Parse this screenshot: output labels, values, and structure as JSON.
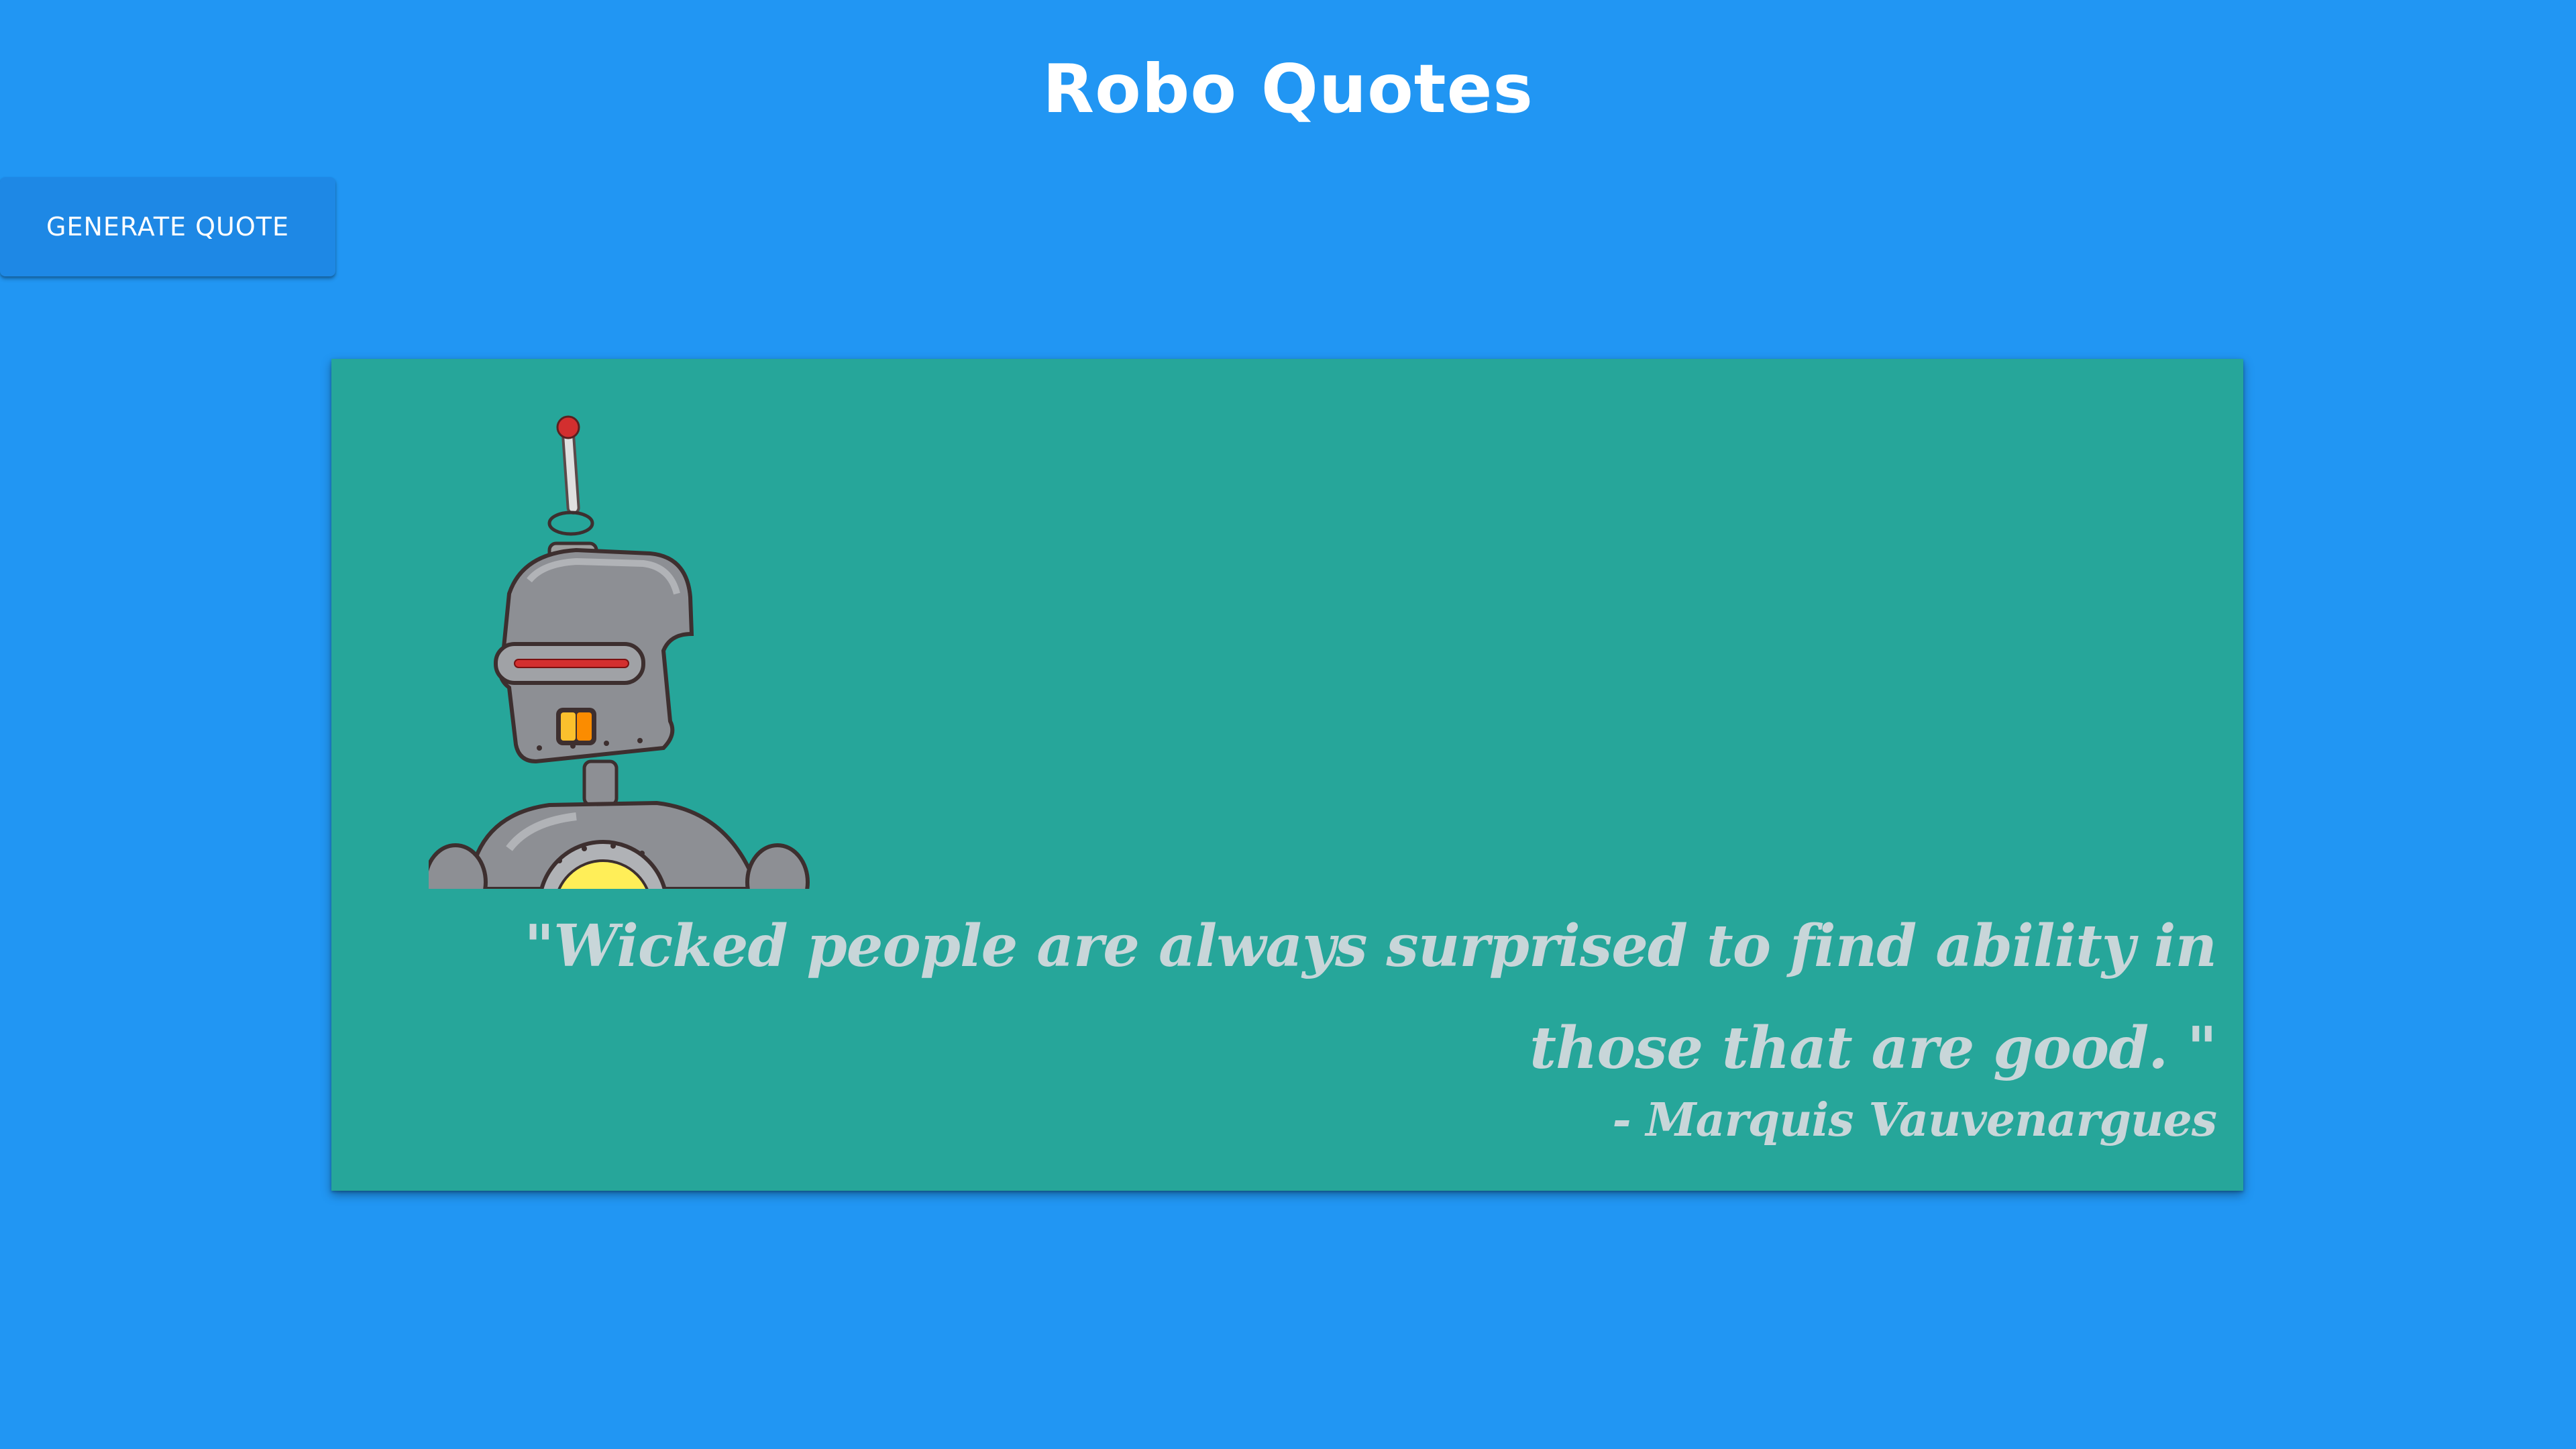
{
  "header": {
    "title": "Robo Quotes"
  },
  "toolbar": {
    "generate_label": "GENERATE QUOTE"
  },
  "quote_card": {
    "image": "robot-illustration",
    "quote_text": "\"Wicked people are always surprised to find ability in those that are good. \"",
    "author_text": "- Marquis Vauvenargues"
  },
  "colors": {
    "page_background": "#2196f3",
    "button_background": "#1e88e5",
    "card_background": "#26a69a",
    "quote_text": "#c8d6d9"
  }
}
